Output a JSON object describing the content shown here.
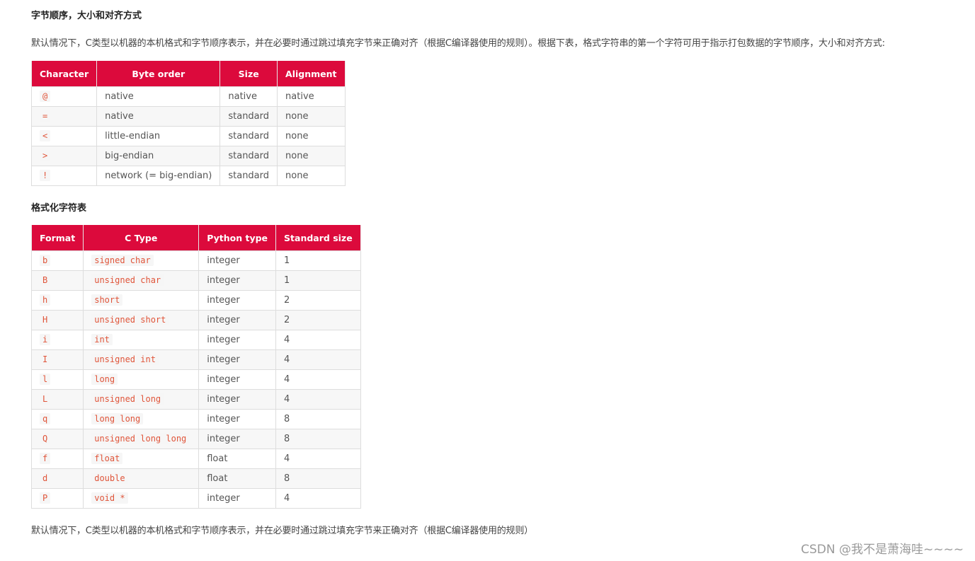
{
  "section1": {
    "title": "字节顺序，大小和对齐方式",
    "intro": "默认情况下，C类型以机器的本机格式和字节顺序表示，并在必要时通过跳过填充字节来正确对齐（根据C编译器使用的规则）。根据下表，格式字符串的第一个字符可用于指示打包数据的字节顺序，大小和对齐方式:",
    "table": {
      "headers": [
        "Character",
        "Byte order",
        "Size",
        "Alignment"
      ],
      "rows": [
        [
          "@",
          "native",
          "native",
          "native"
        ],
        [
          "=",
          "native",
          "standard",
          "none"
        ],
        [
          "<",
          "little-endian",
          "standard",
          "none"
        ],
        [
          ">",
          "big-endian",
          "standard",
          "none"
        ],
        [
          "!",
          "network (= big-endian)",
          "standard",
          "none"
        ]
      ]
    }
  },
  "section2": {
    "title": "格式化字符表",
    "table": {
      "headers": [
        "Format",
        "C Type",
        "Python type",
        "Standard size"
      ],
      "rows": [
        [
          "b",
          "signed char",
          "integer",
          "1"
        ],
        [
          "B",
          "unsigned char",
          "integer",
          "1"
        ],
        [
          "h",
          "short",
          "integer",
          "2"
        ],
        [
          "H",
          "unsigned short",
          "integer",
          "2"
        ],
        [
          "i",
          "int",
          "integer",
          "4"
        ],
        [
          "I",
          "unsigned int",
          "integer",
          "4"
        ],
        [
          "l",
          "long",
          "integer",
          "4"
        ],
        [
          "L",
          "unsigned long",
          "integer",
          "4"
        ],
        [
          "q",
          "long long",
          "integer",
          "8"
        ],
        [
          "Q",
          "unsigned long long",
          "integer",
          "8"
        ],
        [
          "f",
          "float",
          "float",
          "4"
        ],
        [
          "d",
          "double",
          "float",
          "8"
        ],
        [
          "P",
          "void *",
          "integer",
          "4"
        ]
      ]
    }
  },
  "footer_text": "默认情况下，C类型以机器的本机格式和字节顺序表示，并在必要时通过跳过填充字节来正确对齐（根据C编译器使用的规则）",
  "watermark": "CSDN @我不是萧海哇~~~~",
  "colors": {
    "header_bg": "#dc0a3c",
    "code_text": "#e0553a",
    "alt_row_bg": "#f7f7f7"
  }
}
